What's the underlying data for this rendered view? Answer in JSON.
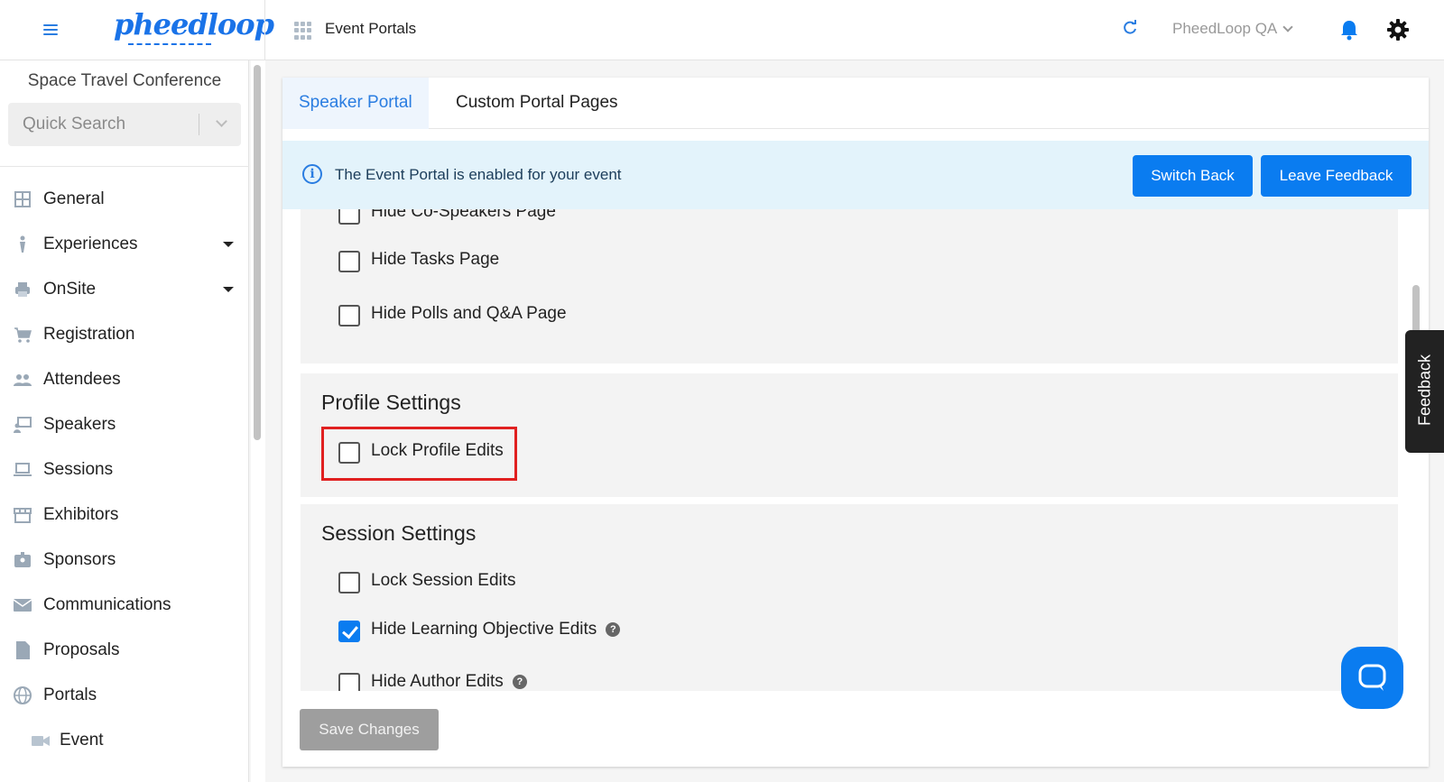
{
  "header": {
    "logo_text": "pheedloop",
    "breadcrumb": "Event Portals",
    "account_name": "PheedLoop QA"
  },
  "sidebar": {
    "event_name": "Space Travel Conference",
    "search": {
      "placeholder": "Quick Search",
      "value": ""
    },
    "items": [
      {
        "label": "General",
        "icon": "grid-icon",
        "expandable": false
      },
      {
        "label": "Experiences",
        "icon": "person-icon",
        "expandable": true
      },
      {
        "label": "OnSite",
        "icon": "printer-icon",
        "expandable": true
      },
      {
        "label": "Registration",
        "icon": "cart-icon",
        "expandable": false
      },
      {
        "label": "Attendees",
        "icon": "people-icon",
        "expandable": false
      },
      {
        "label": "Speakers",
        "icon": "presenter-icon",
        "expandable": false
      },
      {
        "label": "Sessions",
        "icon": "laptop-icon",
        "expandable": false
      },
      {
        "label": "Exhibitors",
        "icon": "store-icon",
        "expandable": false
      },
      {
        "label": "Sponsors",
        "icon": "badge-icon",
        "expandable": false
      },
      {
        "label": "Communications",
        "icon": "mail-icon",
        "expandable": false
      },
      {
        "label": "Proposals",
        "icon": "document-icon",
        "expandable": false
      },
      {
        "label": "Portals",
        "icon": "globe-icon",
        "expandable": false
      }
    ],
    "sub_items": [
      {
        "label": "Event",
        "icon": "video-camera-icon"
      }
    ]
  },
  "tabs": [
    {
      "label": "Speaker Portal",
      "active": true
    },
    {
      "label": "Custom Portal Pages",
      "active": false
    }
  ],
  "banner": {
    "text": "The Event Portal is enabled for your event",
    "switch_back_label": "Switch Back",
    "leave_feedback_label": "Leave Feedback"
  },
  "page_settings": {
    "options": [
      {
        "label": "Hide Co-Speakers Page",
        "checked": false
      },
      {
        "label": "Hide Tasks Page",
        "checked": false
      },
      {
        "label": "Hide Polls and Q&A Page",
        "checked": false
      }
    ]
  },
  "profile_settings": {
    "title": "Profile Settings",
    "options": [
      {
        "label": "Lock Profile Edits",
        "checked": false,
        "highlighted": true
      }
    ]
  },
  "session_settings": {
    "title": "Session Settings",
    "options": [
      {
        "label": "Lock Session Edits",
        "checked": false,
        "help": false
      },
      {
        "label": "Hide Learning Objective Edits",
        "checked": true,
        "help": true
      },
      {
        "label": "Hide Author Edits",
        "checked": false,
        "help": true
      }
    ]
  },
  "save_label": "Save Changes",
  "feedback_tab_label": "Feedback",
  "colors": {
    "accent": "#0a7cf0",
    "banner_bg": "#e3f3fb",
    "highlight": "#e02020",
    "disabled_button": "#9e9e9e"
  }
}
